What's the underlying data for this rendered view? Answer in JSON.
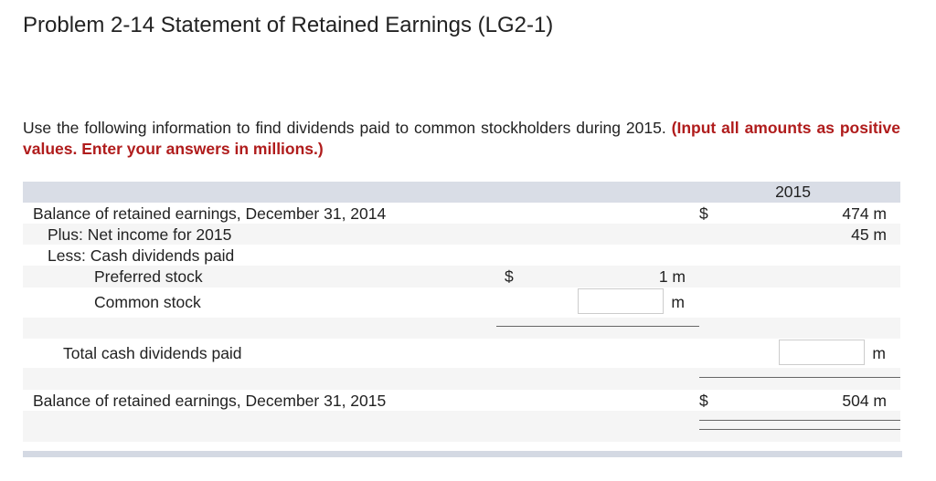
{
  "title": "Problem 2-14 Statement of Retained Earnings (LG2-1)",
  "instructions": {
    "text": "Use the following information to find dividends paid to common stockholders during 2015.",
    "emphasis": "(Input all amounts as positive values. Enter your answers in millions.)"
  },
  "table": {
    "column_header": "2015",
    "rows": {
      "beginning": {
        "label": "Balance of retained earnings, December 31, 2014",
        "currency": "$",
        "value": "474 m"
      },
      "net_income": {
        "label": "Plus: Net income for 2015",
        "value": "45 m"
      },
      "less": {
        "label": "Less: Cash dividends paid"
      },
      "preferred": {
        "label": "Preferred stock",
        "currency": "$",
        "value": "1 m"
      },
      "common": {
        "label": "Common stock",
        "input_value": "",
        "unit": "m"
      },
      "total": {
        "label": "Total cash dividends paid",
        "input_value": "",
        "unit": "m"
      },
      "ending": {
        "label": "Balance of retained earnings, December 31, 2015",
        "currency": "$",
        "value": "504 m"
      }
    }
  },
  "colors": {
    "emphasis": "#b01c1c",
    "header_bg": "#d9dde6",
    "stripe": "#f5f5f5"
  }
}
